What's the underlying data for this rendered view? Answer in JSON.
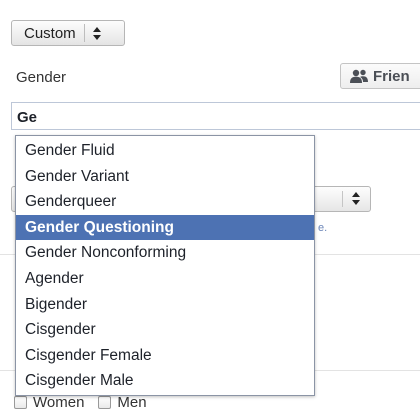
{
  "audience_select": {
    "value": "Custom"
  },
  "gender": {
    "label": "Gender",
    "input_value": "Ge"
  },
  "friends_button": {
    "label": "Frien",
    "icon": "friends-icon"
  },
  "dropdown": {
    "items": [
      {
        "label": "Gender Fluid",
        "selected": false
      },
      {
        "label": "Gender Variant",
        "selected": false
      },
      {
        "label": "Genderqueer",
        "selected": false
      },
      {
        "label": "Gender Questioning",
        "selected": true
      },
      {
        "label": "Gender Nonconforming",
        "selected": false
      },
      {
        "label": "Agender",
        "selected": false
      },
      {
        "label": "Bigender",
        "selected": false
      },
      {
        "label": "Cisgender",
        "selected": false
      },
      {
        "label": "Cisgender Female",
        "selected": false
      },
      {
        "label": "Cisgender Male",
        "selected": false
      }
    ],
    "selected_color": "#4d72b3"
  },
  "background_hint": {
    "text": "e."
  },
  "interested_in": {
    "women_label": "Women",
    "men_label": "Men"
  }
}
